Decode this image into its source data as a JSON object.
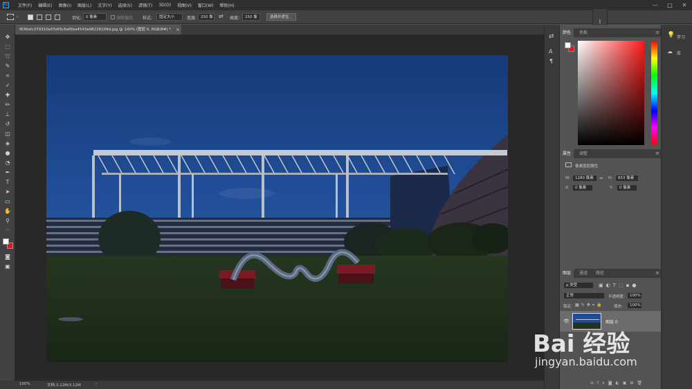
{
  "menubar": {
    "logo": "Ps",
    "items": [
      "文件(F)",
      "编辑(E)",
      "图像(I)",
      "图层(L)",
      "文字(Y)",
      "选择(S)",
      "滤镜(T)",
      "3D(D)",
      "视图(V)",
      "窗口(W)",
      "帮助(H)"
    ],
    "minimize": "—",
    "maximize": "□",
    "close": "✕"
  },
  "options": {
    "feather_label": "羽化:",
    "feather_value": "0 像素",
    "antialias_label": "消除锯齿",
    "style_label": "样式:",
    "style_value": "固定大小",
    "width_label": "宽度:",
    "width_value": "250 像",
    "height_label": "高度:",
    "height_value": "250 像",
    "select_mask_button": "选择并遮住..."
  },
  "document": {
    "tab_title": "f636afc379310a55df3c6af0ba4543a98226109d.jpg @ 100% (图层 0, RGB/8#) *",
    "zoom": "100%",
    "doc_info": "文档:3.12M/3.12M"
  },
  "panels": {
    "color_tabs": [
      "颜色",
      "色板"
    ],
    "properties_tabs": [
      "属性",
      "调整"
    ],
    "properties_header": "像素图层属性",
    "w_label": "W:",
    "w_value": "1280 像素",
    "h_label": "H:",
    "h_value": "853 像素",
    "x_label": "X:",
    "x_value": "0 像素",
    "y_label": "Y:",
    "y_value": "0 像素",
    "link_icon": "∞",
    "layers_tabs": [
      "图层",
      "通道",
      "路径"
    ],
    "kind_value": "ρ 类型",
    "blend_mode": "正常",
    "opacity_label": "不透明度:",
    "opacity_value": "100%",
    "lock_label": "锁定:",
    "fill_label": "填充:",
    "fill_value": "100%",
    "layer_name": "图层 0"
  },
  "learn": {
    "learn_label": "学习",
    "library_label": "库"
  },
  "watermark": {
    "brand": "Bai 经验",
    "url": "jingyan.baidu.com"
  },
  "colors": {
    "foreground": "#ffffff",
    "background": "#e0161b",
    "accent": "#31a8ff"
  }
}
